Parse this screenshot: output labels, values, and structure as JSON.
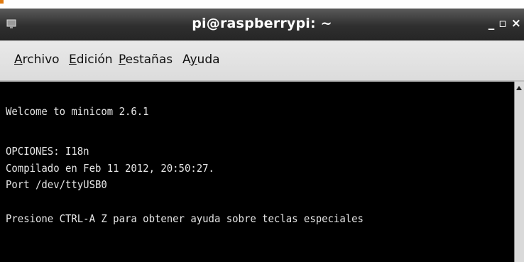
{
  "window": {
    "title": "pi@raspberrypi: ~",
    "controls": {
      "minimize": "_",
      "maximize": "▫",
      "close": "×"
    }
  },
  "menu": {
    "items": [
      {
        "label": "Archivo",
        "mnemonic": "A"
      },
      {
        "label": "Edición",
        "mnemonic": "E"
      },
      {
        "label": "Pestañas",
        "mnemonic": "P"
      },
      {
        "label": "Ayuda",
        "mnemonic": "y"
      }
    ]
  },
  "terminal": {
    "lines": [
      "Welcome to minicom 2.6.1",
      "OPCIONES: I18n",
      "Compilado en Feb 11 2012, 20:50:27.",
      "Port /dev/ttyUSB0",
      "Presione CTRL-A Z para obtener ayuda sobre teclas especiales"
    ]
  },
  "colors": {
    "titlebar": "#2f2f2f",
    "menubar": "#dcdcdc",
    "terminal_bg": "#000000",
    "terminal_fg": "#e6e6e6"
  }
}
